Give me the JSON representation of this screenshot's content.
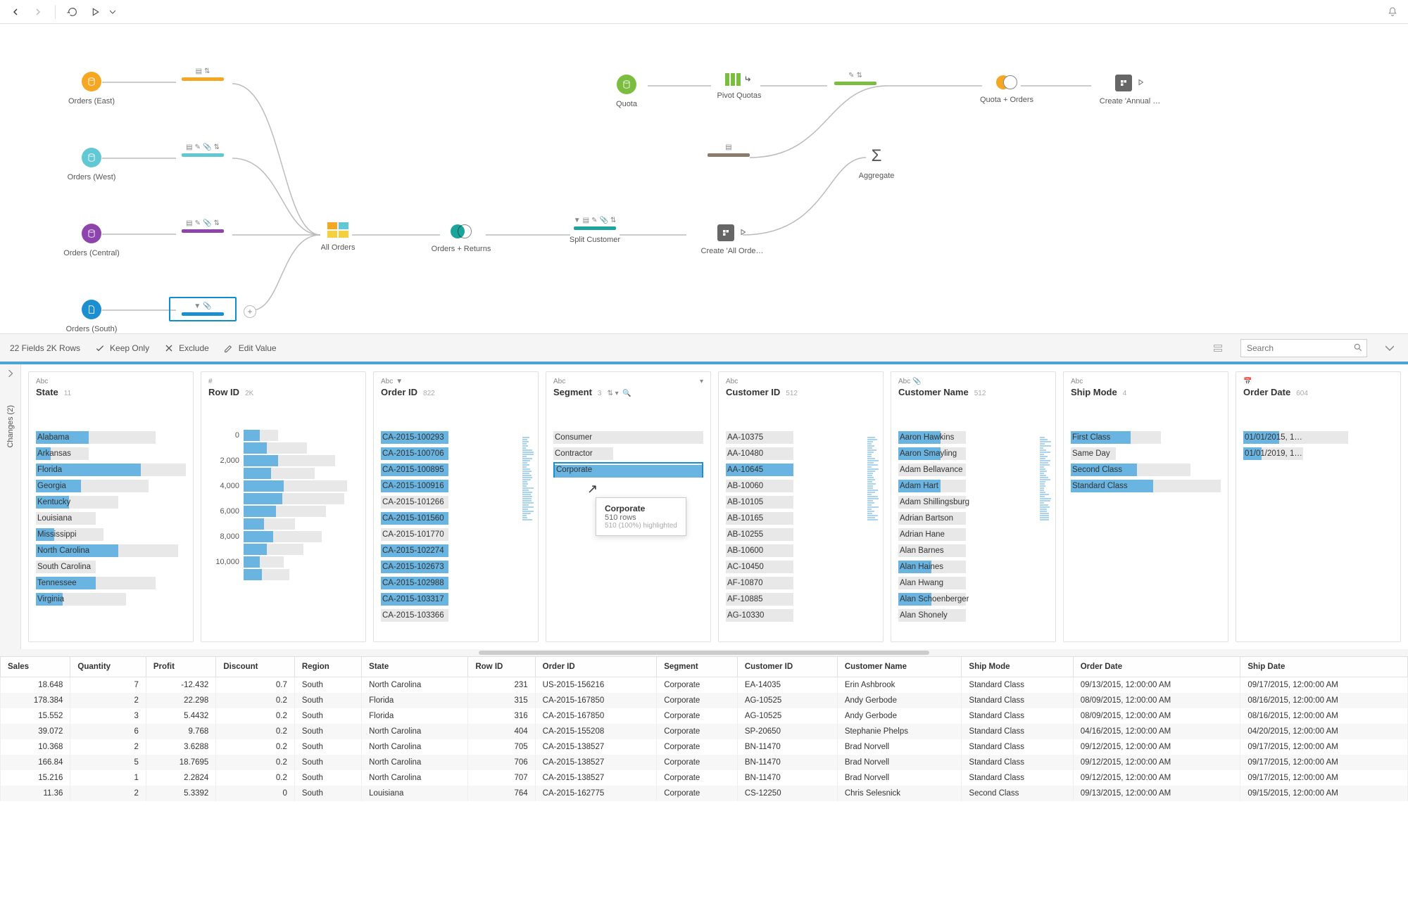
{
  "toolbar": {},
  "flow": {
    "nodes": {
      "orders_east": {
        "label": "Orders (East)"
      },
      "orders_west": {
        "label": "Orders (West)"
      },
      "orders_central": {
        "label": "Orders (Central)"
      },
      "orders_south": {
        "label": "Orders (South)"
      },
      "all_orders": {
        "label": "All Orders"
      },
      "orders_returns": {
        "label": "Orders + Returns"
      },
      "split_customer": {
        "label": "Split Customer"
      },
      "quota": {
        "label": "Quota"
      },
      "pivot_quotas": {
        "label": "Pivot Quotas"
      },
      "aggregate": {
        "label": "Aggregate"
      },
      "quota_orders": {
        "label": "Quota + Orders"
      },
      "create_all": {
        "label": "Create 'All Orde…"
      },
      "create_annual": {
        "label": "Create 'Annual …"
      }
    }
  },
  "profile_toolbar": {
    "summary": "22 Fields  2K Rows",
    "keep_only": "Keep Only",
    "exclude": "Exclude",
    "edit_value": "Edit Value",
    "search_placeholder": "Search"
  },
  "changes": {
    "label": "Changes (2)"
  },
  "cards": [
    {
      "type": "Abc",
      "title": "State",
      "count": "11",
      "values": [
        {
          "v": "Alabama",
          "bg": 80,
          "fg": 35
        },
        {
          "v": "Arkansas",
          "bg": 35,
          "fg": 10
        },
        {
          "v": "Florida",
          "bg": 100,
          "fg": 70
        },
        {
          "v": "Georgia",
          "bg": 75,
          "fg": 30
        },
        {
          "v": "Kentucky",
          "bg": 55,
          "fg": 22
        },
        {
          "v": "Louisiana",
          "bg": 40,
          "fg": 0
        },
        {
          "v": "Mississippi",
          "bg": 45,
          "fg": 12
        },
        {
          "v": "North Carolina",
          "bg": 95,
          "fg": 55
        },
        {
          "v": "South Carolina",
          "bg": 40,
          "fg": 0
        },
        {
          "v": "Tennessee",
          "bg": 80,
          "fg": 40
        },
        {
          "v": "Virginia",
          "bg": 60,
          "fg": 18
        }
      ]
    },
    {
      "type": "#",
      "title": "Row ID",
      "count": "2K",
      "histo_labels": [
        "0",
        "2,000",
        "4,000",
        "6,000",
        "8,000",
        "10,000"
      ],
      "bars": [
        {
          "bg": 30,
          "fg": 14
        },
        {
          "bg": 55,
          "fg": 20
        },
        {
          "bg": 80,
          "fg": 30
        },
        {
          "bg": 62,
          "fg": 24
        },
        {
          "bg": 90,
          "fg": 35
        },
        {
          "bg": 88,
          "fg": 34
        },
        {
          "bg": 72,
          "fg": 28
        },
        {
          "bg": 45,
          "fg": 18
        },
        {
          "bg": 68,
          "fg": 26
        },
        {
          "bg": 52,
          "fg": 20
        },
        {
          "bg": 35,
          "fg": 14
        },
        {
          "bg": 40,
          "fg": 16
        }
      ]
    },
    {
      "type": "Abc",
      "title": "Order ID",
      "count": "822",
      "filtered": true,
      "values": [
        {
          "v": "CA-2015-100293",
          "bg": 45,
          "fg": 45
        },
        {
          "v": "CA-2015-100706",
          "bg": 45,
          "fg": 45
        },
        {
          "v": "CA-2015-100895",
          "bg": 45,
          "fg": 45
        },
        {
          "v": "CA-2015-100916",
          "bg": 45,
          "fg": 45
        },
        {
          "v": "CA-2015-101266",
          "bg": 45,
          "fg": 0
        },
        {
          "v": "CA-2015-101560",
          "bg": 45,
          "fg": 45
        },
        {
          "v": "CA-2015-101770",
          "bg": 45,
          "fg": 0
        },
        {
          "v": "CA-2015-102274",
          "bg": 45,
          "fg": 45
        },
        {
          "v": "CA-2015-102673",
          "bg": 45,
          "fg": 45
        },
        {
          "v": "CA-2015-102988",
          "bg": 45,
          "fg": 45
        },
        {
          "v": "CA-2015-103317",
          "bg": 45,
          "fg": 45
        },
        {
          "v": "CA-2015-103366",
          "bg": 45,
          "fg": 0
        }
      ]
    },
    {
      "type": "Abc",
      "title": "Segment",
      "count": "3",
      "values": [
        {
          "v": "Consumer",
          "bg": 100,
          "fg": 0
        },
        {
          "v": "Contractor",
          "bg": 40,
          "fg": 0
        },
        {
          "v": "Corporate",
          "bg": 100,
          "fg": 100,
          "selected": true
        }
      ],
      "tooltip": {
        "title": "Corporate",
        "rows": "510 rows",
        "highlight": "510 (100%) highlighted"
      }
    },
    {
      "type": "Abc",
      "title": "Customer ID",
      "count": "512",
      "values": [
        {
          "v": "AA-10375",
          "bg": 45,
          "fg": 0
        },
        {
          "v": "AA-10480",
          "bg": 45,
          "fg": 0
        },
        {
          "v": "AA-10645",
          "bg": 45,
          "fg": 45
        },
        {
          "v": "AB-10060",
          "bg": 45,
          "fg": 0
        },
        {
          "v": "AB-10105",
          "bg": 45,
          "fg": 0
        },
        {
          "v": "AB-10165",
          "bg": 45,
          "fg": 0
        },
        {
          "v": "AB-10255",
          "bg": 45,
          "fg": 0
        },
        {
          "v": "AB-10600",
          "bg": 45,
          "fg": 0
        },
        {
          "v": "AC-10450",
          "bg": 45,
          "fg": 0
        },
        {
          "v": "AF-10870",
          "bg": 45,
          "fg": 0
        },
        {
          "v": "AF-10885",
          "bg": 45,
          "fg": 0
        },
        {
          "v": "AG-10330",
          "bg": 45,
          "fg": 0
        }
      ]
    },
    {
      "type": "Abc",
      "title": "Customer Name",
      "count": "512",
      "values": [
        {
          "v": "Aaron Hawkins",
          "bg": 45,
          "fg": 28
        },
        {
          "v": "Aaron Smayling",
          "bg": 45,
          "fg": 28
        },
        {
          "v": "Adam Bellavance",
          "bg": 45,
          "fg": 0
        },
        {
          "v": "Adam Hart",
          "bg": 45,
          "fg": 28
        },
        {
          "v": "Adam Shillingsburg",
          "bg": 45,
          "fg": 0
        },
        {
          "v": "Adrian Bartson",
          "bg": 45,
          "fg": 0
        },
        {
          "v": "Adrian Hane",
          "bg": 45,
          "fg": 0
        },
        {
          "v": "Alan Barnes",
          "bg": 45,
          "fg": 0
        },
        {
          "v": "Alan Haines",
          "bg": 45,
          "fg": 22
        },
        {
          "v": "Alan Hwang",
          "bg": 45,
          "fg": 0
        },
        {
          "v": "Alan Schoenberger",
          "bg": 45,
          "fg": 22
        },
        {
          "v": "Alan Shonely",
          "bg": 45,
          "fg": 0
        }
      ]
    },
    {
      "type": "Abc",
      "title": "Ship Mode",
      "count": "4",
      "values": [
        {
          "v": "First Class",
          "bg": 60,
          "fg": 40
        },
        {
          "v": "Same Day",
          "bg": 30,
          "fg": 0
        },
        {
          "v": "Second Class",
          "bg": 80,
          "fg": 44
        },
        {
          "v": "Standard Class",
          "bg": 100,
          "fg": 55
        }
      ]
    },
    {
      "type": "date",
      "title": "Order Date",
      "count": "604",
      "values": [
        {
          "v": "01/01/2015, 1…",
          "bg": 70,
          "fg": 24
        },
        {
          "v": "01/01/2019, 1…",
          "bg": 40,
          "fg": 12
        }
      ]
    }
  ],
  "grid": {
    "headers": [
      "Sales",
      "Quantity",
      "Profit",
      "Discount",
      "Region",
      "State",
      "Row ID",
      "Order ID",
      "Segment",
      "Customer ID",
      "Customer Name",
      "Ship Mode",
      "Order Date",
      "Ship Date"
    ],
    "rows": [
      [
        "18.648",
        "7",
        "-12.432",
        "0.7",
        "South",
        "North Carolina",
        "231",
        "US-2015-156216",
        "Corporate",
        "EA-14035",
        "Erin Ashbrook",
        "Standard Class",
        "09/13/2015, 12:00:00 AM",
        "09/17/2015, 12:00:00 AM"
      ],
      [
        "178.384",
        "2",
        "22.298",
        "0.2",
        "South",
        "Florida",
        "315",
        "CA-2015-167850",
        "Corporate",
        "AG-10525",
        "Andy Gerbode",
        "Standard Class",
        "08/09/2015, 12:00:00 AM",
        "08/16/2015, 12:00:00 AM"
      ],
      [
        "15.552",
        "3",
        "5.4432",
        "0.2",
        "South",
        "Florida",
        "316",
        "CA-2015-167850",
        "Corporate",
        "AG-10525",
        "Andy Gerbode",
        "Standard Class",
        "08/09/2015, 12:00:00 AM",
        "08/16/2015, 12:00:00 AM"
      ],
      [
        "39.072",
        "6",
        "9.768",
        "0.2",
        "South",
        "North Carolina",
        "404",
        "CA-2015-155208",
        "Corporate",
        "SP-20650",
        "Stephanie Phelps",
        "Standard Class",
        "04/16/2015, 12:00:00 AM",
        "04/20/2015, 12:00:00 AM"
      ],
      [
        "10.368",
        "2",
        "3.6288",
        "0.2",
        "South",
        "North Carolina",
        "705",
        "CA-2015-138527",
        "Corporate",
        "BN-11470",
        "Brad Norvell",
        "Standard Class",
        "09/12/2015, 12:00:00 AM",
        "09/17/2015, 12:00:00 AM"
      ],
      [
        "166.84",
        "5",
        "18.7695",
        "0.2",
        "South",
        "North Carolina",
        "706",
        "CA-2015-138527",
        "Corporate",
        "BN-11470",
        "Brad Norvell",
        "Standard Class",
        "09/12/2015, 12:00:00 AM",
        "09/17/2015, 12:00:00 AM"
      ],
      [
        "15.216",
        "1",
        "2.2824",
        "0.2",
        "South",
        "North Carolina",
        "707",
        "CA-2015-138527",
        "Corporate",
        "BN-11470",
        "Brad Norvell",
        "Standard Class",
        "09/12/2015, 12:00:00 AM",
        "09/17/2015, 12:00:00 AM"
      ],
      [
        "11.36",
        "2",
        "5.3392",
        "0",
        "South",
        "Louisiana",
        "764",
        "CA-2015-162775",
        "Corporate",
        "CS-12250",
        "Chris Selesnick",
        "Second Class",
        "09/13/2015, 12:00:00 AM",
        "09/15/2015, 12:00:00 AM"
      ]
    ]
  }
}
